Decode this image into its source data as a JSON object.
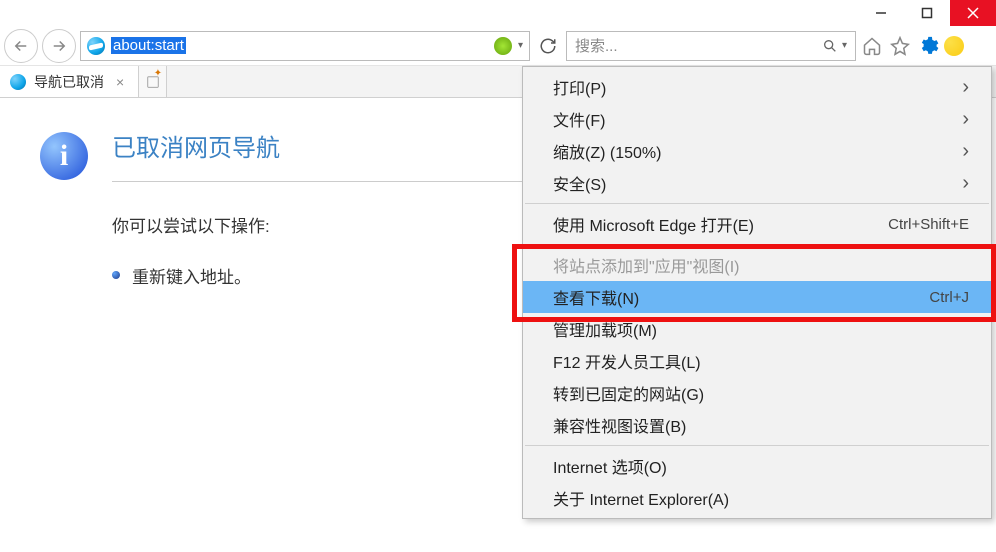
{
  "window": {
    "minimize": "—",
    "maximize": "☐",
    "close": "×"
  },
  "toolbar": {
    "address": "about:start",
    "search_placeholder": "搜索..."
  },
  "tabs": {
    "active_title": "导航已取消"
  },
  "page": {
    "heading": "已取消网页导航",
    "try_label": "你可以尝试以下操作:",
    "action_1": "重新键入地址。"
  },
  "menu": {
    "print": "打印(P)",
    "file": "文件(F)",
    "zoom": "缩放(Z) (150%)",
    "safety": "安全(S)",
    "open_edge": "使用 Microsoft Edge 打开(E)",
    "open_edge_shortcut": "Ctrl+Shift+E",
    "add_site": "将站点添加到\"应用\"视图(I)",
    "view_downloads": "查看下载(N)",
    "view_downloads_shortcut": "Ctrl+J",
    "manage_addons": "管理加载项(M)",
    "f12": "F12 开发人员工具(L)",
    "pinned": "转到已固定的网站(G)",
    "compat": "兼容性视图设置(B)",
    "internet_options": "Internet 选项(O)",
    "about": "关于 Internet Explorer(A)"
  }
}
